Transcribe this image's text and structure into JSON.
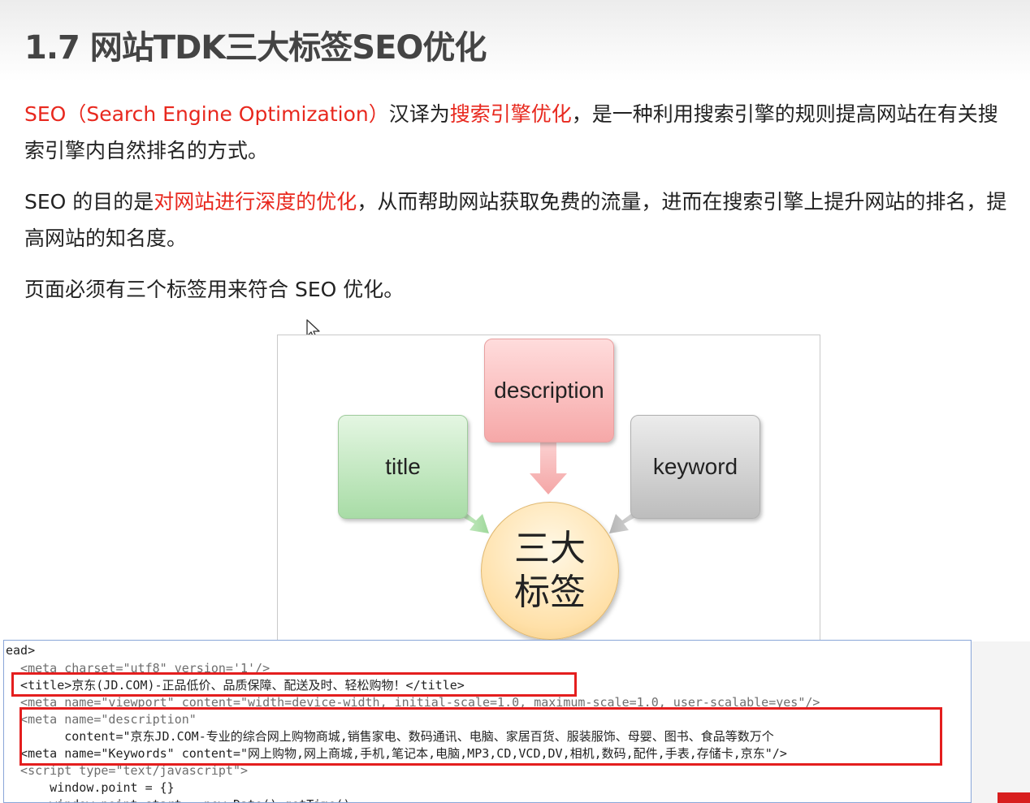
{
  "heading": "1.7 网站TDK三大标签SEO优化",
  "paragraphs": {
    "p1": {
      "red1": "SEO（Search Engine Optimization）",
      "text1": "汉译为",
      "red2": "搜索引擎优化",
      "text2": "，是一种利用搜索引擎的规则提高网站在有关搜索引擎内自然排名的方式。"
    },
    "p2": {
      "text1": "SEO 的目的是",
      "red1": "对网站进行深度的优化",
      "text2": "，从而帮助网站获取免费的流量，进而在搜索引擎上提升网站的排名，提高网站的知名度。"
    },
    "p3": "页面必须有三个标签用来符合 SEO 优化。"
  },
  "diagram": {
    "box_description": "description",
    "box_title": "title",
    "box_keyword": "keyword",
    "center": "三大标签",
    "colors": {
      "description": "#f6a8a8",
      "title": "#a8dca6",
      "keyword": "#bdbdbd",
      "center": "#ffe0a8"
    }
  },
  "code": {
    "lines": [
      "ead>",
      "  <meta charset=\"utf8\" version='1'/>",
      "  <title>京东(JD.COM)-正品低价、品质保障、配送及时、轻松购物！</title>",
      "  <meta name=\"viewport\" content=\"width=device-width, initial-scale=1.0, maximum-scale=1.0, user-scalable=yes\"/>",
      "  <meta name=\"description\"",
      "        content=\"京东JD.COM-专业的综合网上购物商城,销售家电、数码通讯、电脑、家居百货、服装服饰、母婴、图书、食品等数万个",
      "  <meta name=\"Keywords\" content=\"网上购物,网上商城,手机,笔记本,电脑,MP3,CD,VCD,DV,相机,数码,配件,手表,存储卡,京东\"/>",
      "  <script type=\"text/javascript\">",
      "      window.point = {}",
      "      window.point.start = new Date().getTime()"
    ],
    "highlight_color": "#e41e1e"
  }
}
